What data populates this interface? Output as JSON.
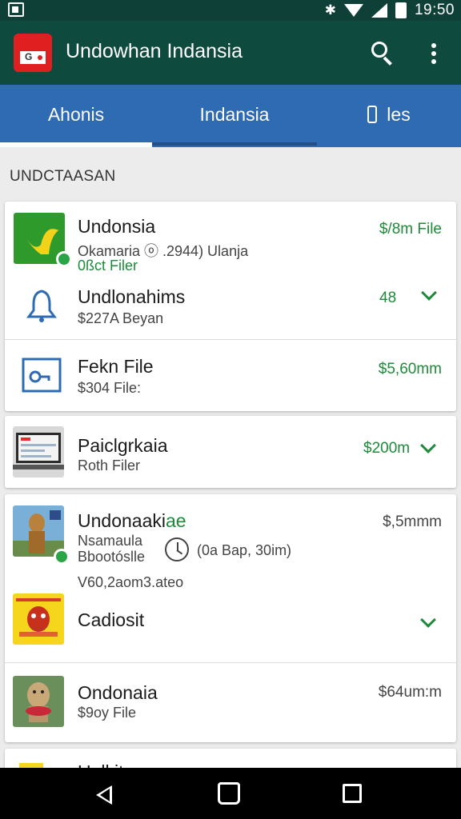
{
  "status_bar": {
    "time": "19:50"
  },
  "app_bar": {
    "title": "Undowhan Indansia"
  },
  "tabs": [
    {
      "label": "Ahonis"
    },
    {
      "label": "Indansia"
    },
    {
      "label": "les"
    }
  ],
  "section": {
    "label": "UNDCTAASAN"
  },
  "items": [
    {
      "title": "Undonsia",
      "subtitle": "Okamaria ⓞ .2944) Ulanja",
      "extra": "0ßct Filer",
      "meta": "$/8m File"
    },
    {
      "title": "Undlonahims",
      "subtitle": "$227A Beyan",
      "meta": "48"
    },
    {
      "title": "Fekn File",
      "subtitle": "$304 File:",
      "meta": "$5,60mm"
    },
    {
      "title": "Paiclgrkaia",
      "subtitle": "Roth Filer",
      "meta": "$200m"
    },
    {
      "title": "Undonaaki",
      "title_accent": "ae",
      "subtitle": "Nsamaula",
      "subtitle2": "Bbootóslle",
      "detail": "(0a Bap, 30im)",
      "extra": "V60,2aom3.ateo",
      "meta": "$,5mmm"
    },
    {
      "title": "Cadiosit"
    },
    {
      "title": "Ondonaia",
      "subtitle": "$9oy File",
      "meta": "$64um:m"
    },
    {
      "title": "Ualkit"
    }
  ],
  "colors": {
    "status_bar": "#0e4038",
    "app_bar": "#0f4a3f",
    "tab_bar": "#2e6bb3",
    "accent_green": "#1e8a3a",
    "background": "#ececec"
  },
  "icons": {
    "search": "search-icon",
    "more": "more-vert-icon",
    "bell": "bell-icon",
    "file": "file-key-icon",
    "chevron": "chevron-down-icon",
    "clock": "clock-icon"
  }
}
